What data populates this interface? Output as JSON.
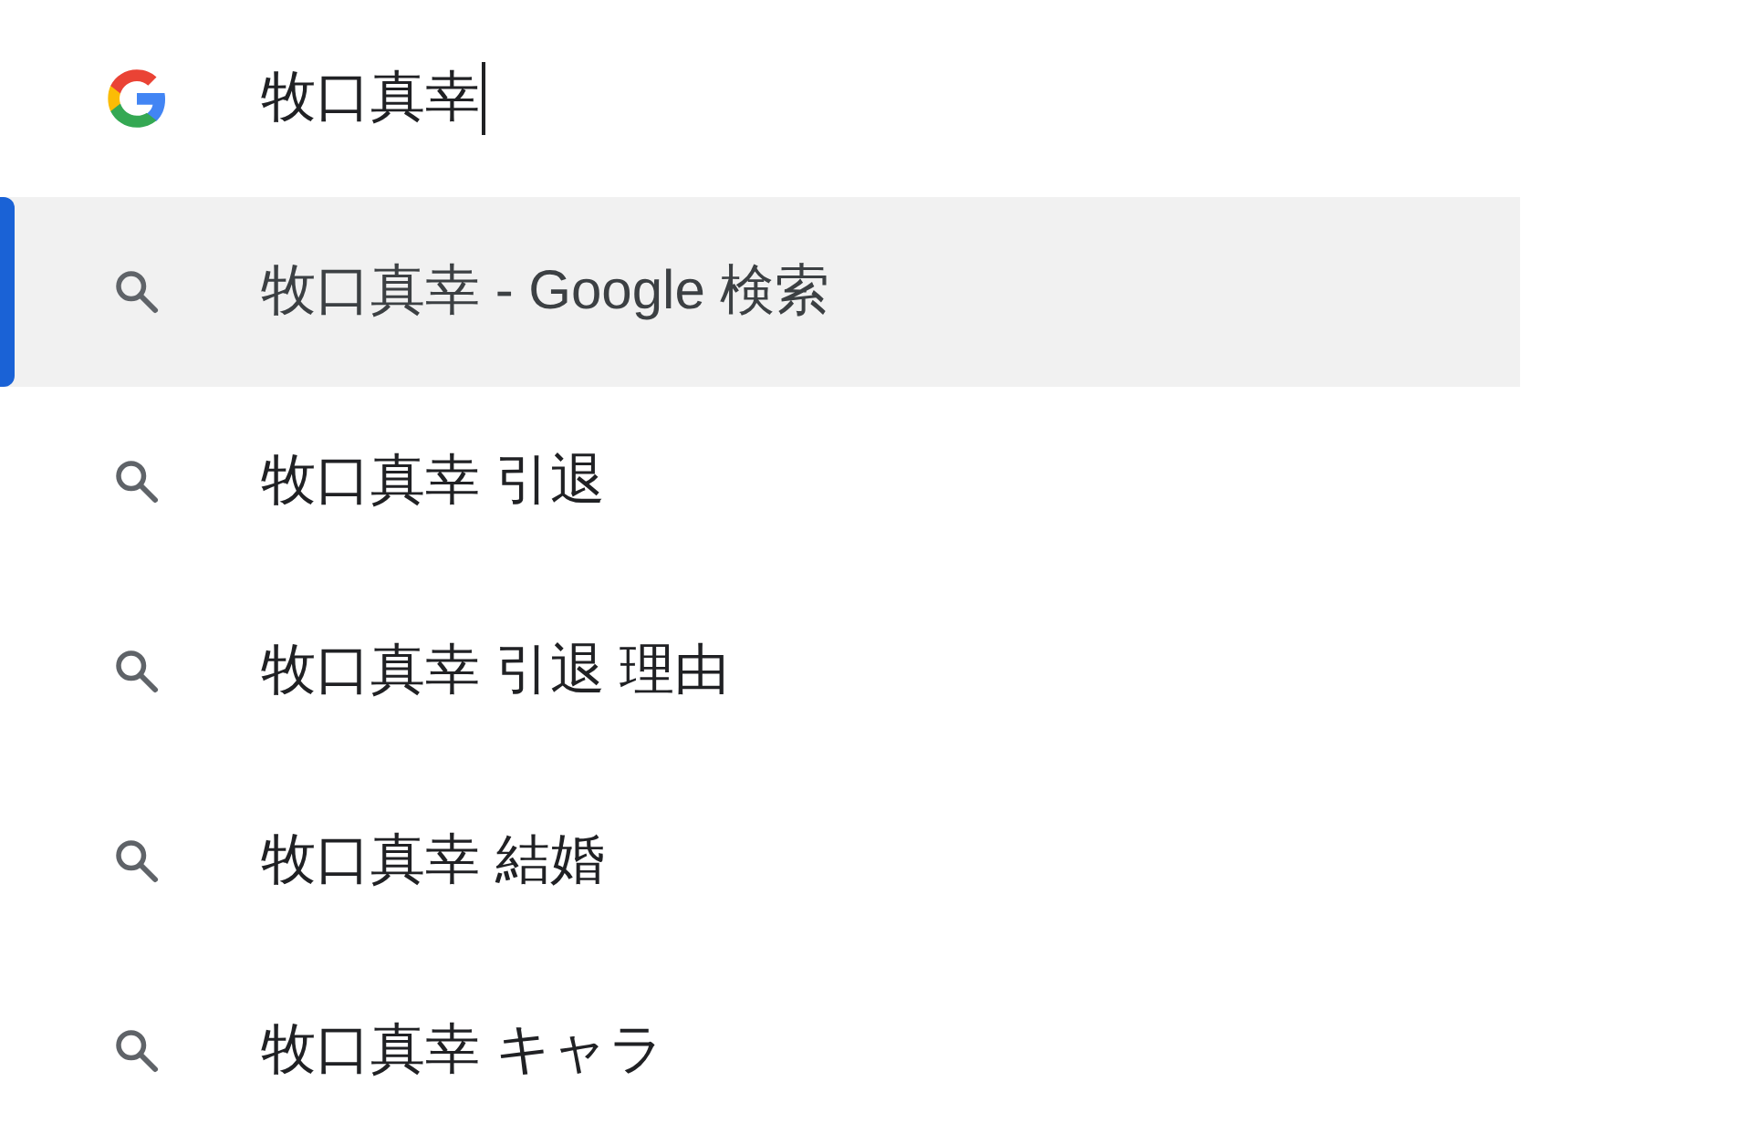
{
  "search": {
    "value": "牧口真幸"
  },
  "suggestions": [
    {
      "text": "牧口真幸 - Google 検索",
      "selected": true
    },
    {
      "text": "牧口真幸 引退",
      "selected": false
    },
    {
      "text": "牧口真幸 引退 理由",
      "selected": false
    },
    {
      "text": "牧口真幸 結婚",
      "selected": false
    },
    {
      "text": "牧口真幸 キャラ",
      "selected": false
    }
  ]
}
